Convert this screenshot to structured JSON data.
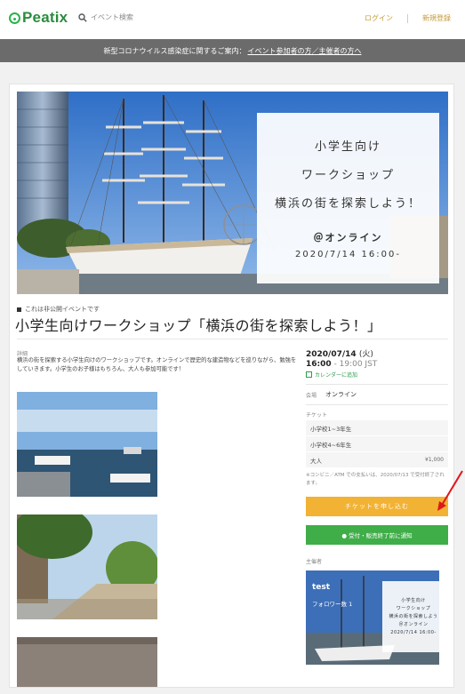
{
  "header": {
    "logo_text": "Peatix",
    "search_placeholder": "イベント検索",
    "login_label": "ログイン",
    "signup_label": "新規登録"
  },
  "notice": {
    "text": "新型コロナウイルス感染症に関するご案内：",
    "link": "イベント参加者の方／主催者の方へ"
  },
  "hero": {
    "line1": "小学生向け",
    "line2": "ワークショップ",
    "line3": "横浜の街を探索しよう！",
    "online": "＠オンライン",
    "date": "2020/7/14 16:00-"
  },
  "event": {
    "private_note": "これは非公開イベントです",
    "title": "小学生向けワークショップ「横浜の街を探索しよう！」",
    "description_label": "詳細",
    "description": "横浜の街を探索する小学生向けのワークショップです。オンラインで歴史的な建造物などを巡りながら、勉強をしていきます。小学生のお子様はもちろん、大人も参加可能です！"
  },
  "sidebar": {
    "date": "2020/07/14",
    "dow": "(火)",
    "time_start": "16:00",
    "time_end": " - 19:00 JST",
    "calendar_link": "カレンダーに追加",
    "venue_label": "会場",
    "venue": "オンライン",
    "ticket_label": "チケット",
    "tickets": [
      {
        "name": "小学校1~3年生",
        "price": ""
      },
      {
        "name": "小学校4~6年生",
        "price": ""
      },
      {
        "name": "大人",
        "price": "¥1,000"
      }
    ],
    "ticket_note": "※コンビニ／ATM での支払いは、2020/07/13 で受付終了されます。",
    "apply_button": "チケットを申し込む",
    "notify_button": "● 受付・販売終了前に通知",
    "organizer_label": "主催者",
    "organizer_name": "test",
    "organizer_followers": "フォロワー数 1",
    "org_box": {
      "line1": "小学生向け",
      "line2": "ワークショップ",
      "line3": "横浜の街を探索しよう",
      "line4": "＠オンライン",
      "line5": "2020/7/14 16:00-"
    }
  },
  "colors": {
    "brand_green": "#2b8c3d",
    "apply_orange": "#f2b233",
    "notify_green": "#3fae48",
    "notice_gray": "#6b6b6b",
    "annotation_red": "#e0161b"
  }
}
